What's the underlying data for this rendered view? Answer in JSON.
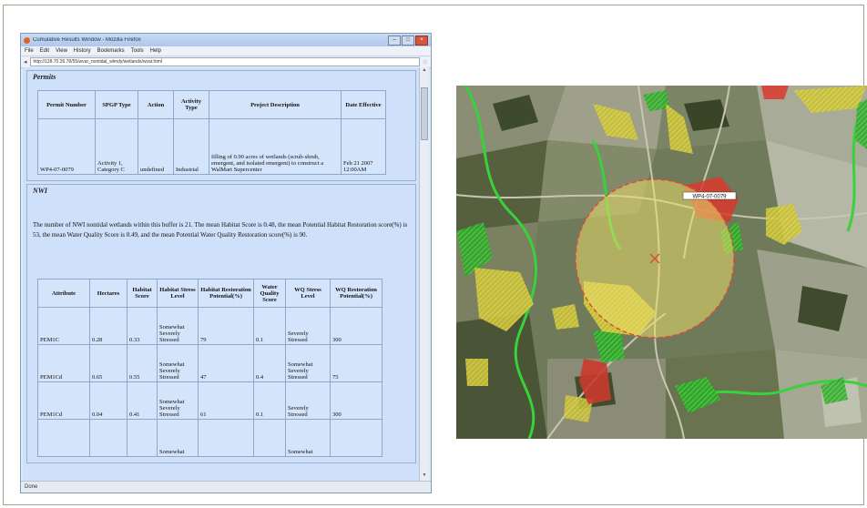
{
  "window": {
    "title": "Cumulative Results Window - Mozilla Firefox",
    "menu": [
      "File",
      "Edit",
      "View",
      "History",
      "Bookmarks",
      "Tools",
      "Help"
    ],
    "url": "http://128.70.26.78/55/wvar_nontidal_wlmdy/wetlands/wvar.html",
    "status": "Done"
  },
  "permits": {
    "legend": "Permits",
    "headers": [
      "Permit Number",
      "SPGP Type",
      "Action",
      "Activity Type",
      "Project Description",
      "Date Effective"
    ],
    "rows": [
      {
        "permit_number": "WP4-07-0079",
        "spgp_type": "Activity 1, Category C",
        "action": "undefined",
        "activity_type": "Industrial",
        "description": "filling of 0.90 acres of wetlands (scrub-shrub, emergent, and isolated emergent) to construct a WalMart Supercenter",
        "date": "Feb 21 2007 12:00AM"
      }
    ]
  },
  "nwi": {
    "legend": "NWI",
    "text": "The number of NWI nontidal wetlands within this buffer is 21. The mean Habitat Score is 0.48, the mean Potential Habitat Restoration score(%) is 53, the mean Water Quality Score is 0.49, and the mean Potential Water Quality Restoration score(%) is 90.",
    "headers": [
      "Attribute",
      "Hectares",
      "Habitat Score",
      "Habitat Stress Level",
      "Habitat Restoration Potential(%)",
      "Water Quality Score",
      "WQ Stress Level",
      "WQ Restoration Potential(%)"
    ],
    "rows": [
      {
        "attribute": "PEM1C",
        "hectares": "0.28",
        "habitat_score": "0.33",
        "habitat_stress": "Somewhat Severely Stressed",
        "habitat_restoration": "79",
        "wq_score": "0.1",
        "wq_stress": "Severely Stressed",
        "wq_restoration": "300"
      },
      {
        "attribute": "PEM1Cd",
        "hectares": "0.65",
        "habitat_score": "0.55",
        "habitat_stress": "Somewhat Severely Stressed",
        "habitat_restoration": "47",
        "wq_score": "0.4",
        "wq_stress": "Somewhat Severely Stressed",
        "wq_restoration": "75"
      },
      {
        "attribute": "PEM1Cd",
        "hectares": "0.04",
        "habitat_score": "0.41",
        "habitat_stress": "Somewhat Severely Stressed",
        "habitat_restoration": "61",
        "wq_score": "0.1",
        "wq_stress": "Severely Stressed",
        "wq_restoration": "300"
      },
      {
        "attribute": "",
        "hectares": "",
        "habitat_score": "",
        "habitat_stress": "Somewhat",
        "habitat_restoration": "",
        "wq_score": "",
        "wq_stress": "Somewhat",
        "wq_restoration": ""
      }
    ]
  },
  "map": {
    "site_label": "WP4-07-0079",
    "colors": {
      "buffer": "#e9dc6a",
      "high": "#d93a2e",
      "medium": "#e4d53a",
      "low": "#3ecf3a"
    }
  }
}
